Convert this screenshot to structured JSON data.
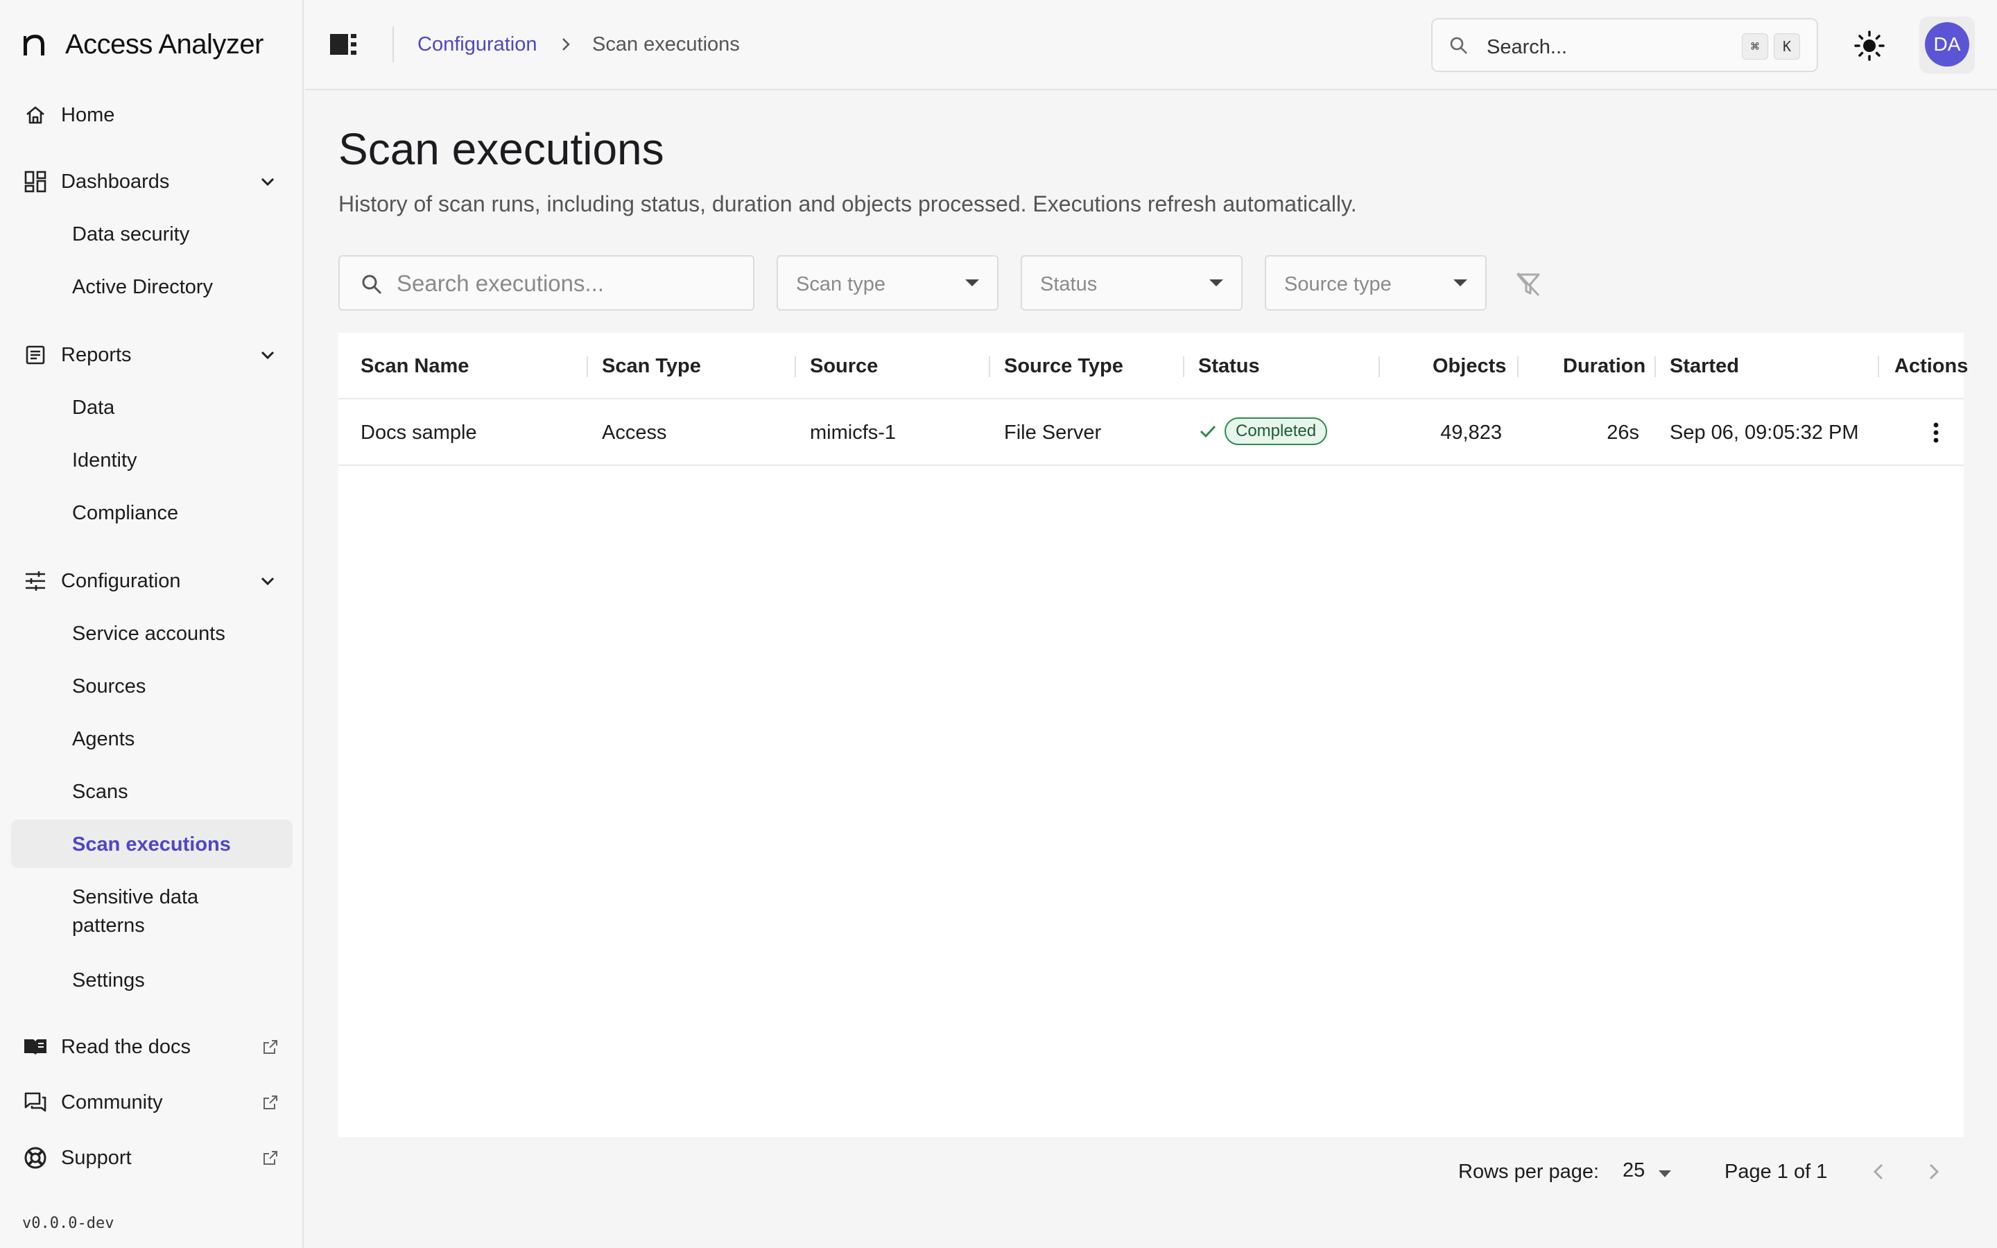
{
  "app": {
    "name": "Access Analyzer",
    "version": "v0.0.0-dev"
  },
  "sidebar": {
    "home": "Home",
    "dashboards": {
      "label": "Dashboards",
      "items": [
        "Data security",
        "Active Directory"
      ]
    },
    "reports": {
      "label": "Reports",
      "items": [
        "Data",
        "Identity",
        "Compliance"
      ]
    },
    "configuration": {
      "label": "Configuration",
      "items": [
        "Service accounts",
        "Sources",
        "Agents",
        "Scans",
        "Scan executions",
        "Sensitive data",
        "patterns",
        "Settings"
      ]
    },
    "read_docs": "Read the docs",
    "community": "Community",
    "support": "Support"
  },
  "header": {
    "breadcrumb_parent": "Configuration",
    "breadcrumb_current": "Scan executions",
    "search_placeholder": "Search...",
    "shortcut_mod": "⌘",
    "shortcut_key": "K",
    "avatar_initials": "DA"
  },
  "page": {
    "title": "Scan executions",
    "description": "History of scan runs, including status, duration and objects processed. Executions refresh automatically."
  },
  "filters": {
    "search_placeholder": "Search executions...",
    "scan_type": "Scan type",
    "status": "Status",
    "source_type": "Source type"
  },
  "table": {
    "columns": [
      "Scan Name",
      "Scan Type",
      "Source",
      "Source Type",
      "Status",
      "Objects",
      "Duration",
      "Started",
      "Actions"
    ],
    "rows": [
      {
        "scan_name": "Docs sample",
        "scan_type": "Access",
        "source": "mimicfs-1",
        "source_type": "File Server",
        "status": "Completed",
        "objects": "49,823",
        "duration": "26s",
        "started": "Sep 06, 09:05:32 PM"
      }
    ]
  },
  "pagination": {
    "rows_per_page_label": "Rows per page:",
    "rows_per_page": "25",
    "page_info": "Page 1 of 1"
  },
  "colors": {
    "accent": "#4f46c8",
    "success": "#2e8a4d",
    "avatar": "#5b55d6"
  }
}
